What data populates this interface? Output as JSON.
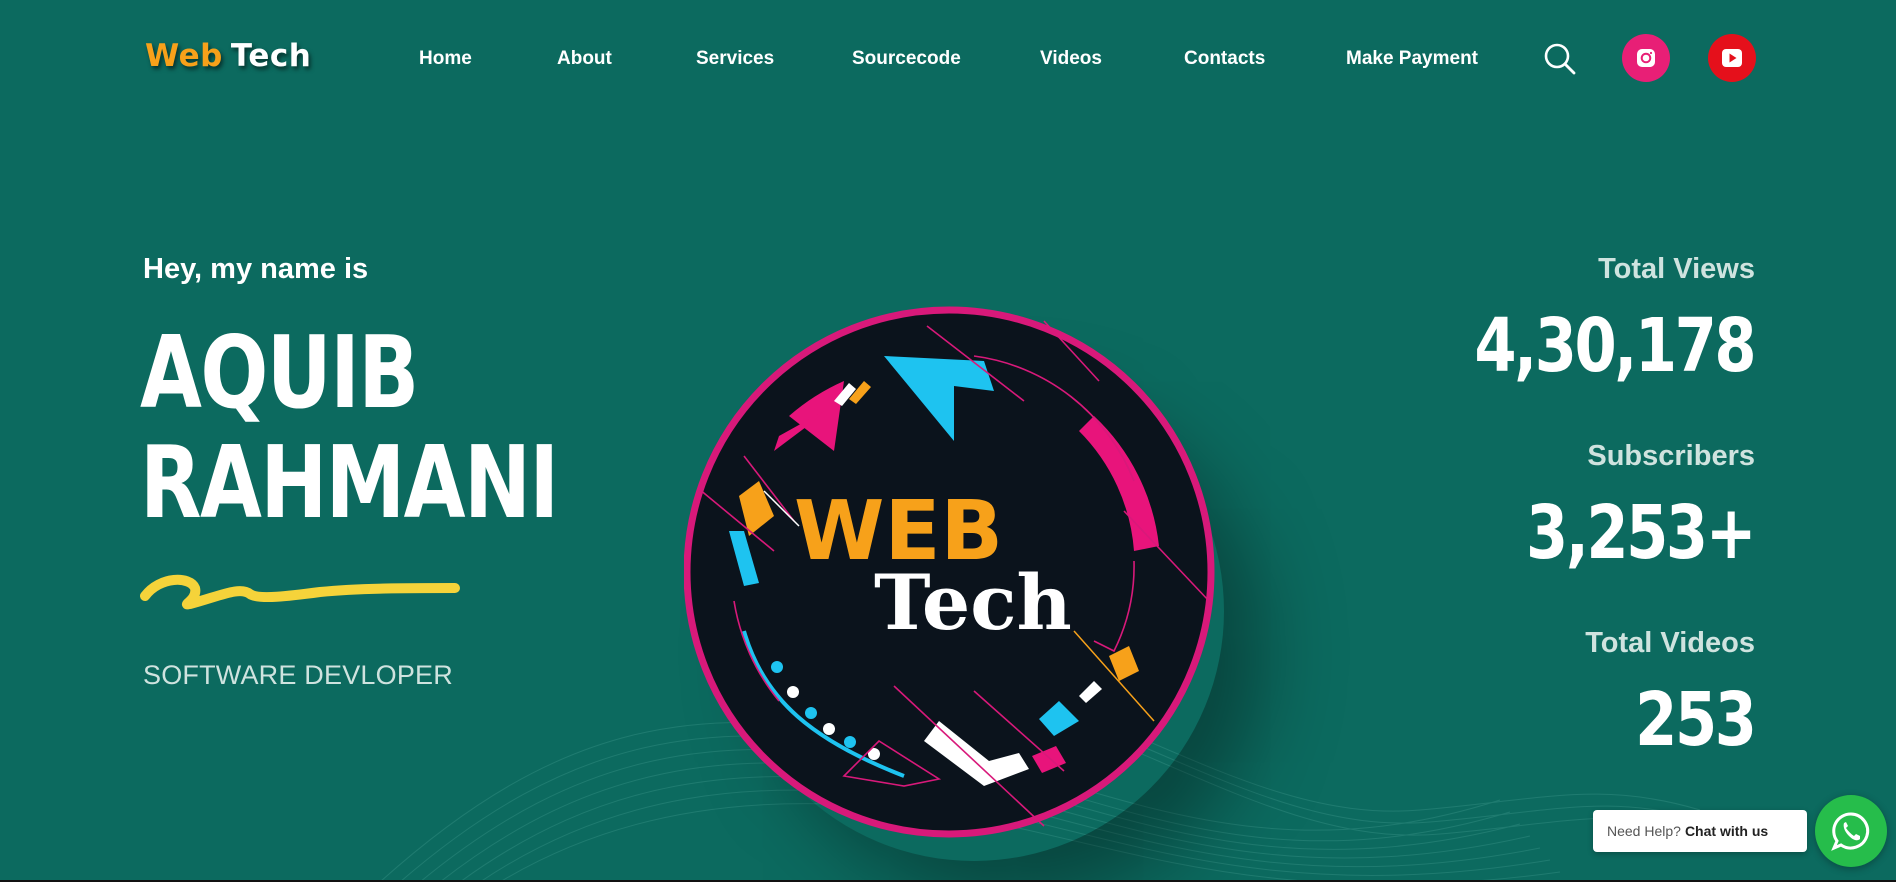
{
  "logo": {
    "part1": "Web",
    "part2": "Tech"
  },
  "nav": {
    "items": [
      {
        "label": "Home"
      },
      {
        "label": "About"
      },
      {
        "label": "Services"
      },
      {
        "label": "Sourcecode"
      },
      {
        "label": "Videos"
      },
      {
        "label": "Contacts"
      },
      {
        "label": "Make Payment"
      }
    ]
  },
  "icons": {
    "search": "search-icon",
    "instagram": "instagram-icon",
    "youtube": "youtube-icon",
    "whatsapp": "whatsapp-icon"
  },
  "hero": {
    "greeting": "Hey, my name is",
    "first_name": "AQUIB",
    "last_name": "RAHMANI",
    "role": "SOFTWARE DEVLOPER"
  },
  "emblem": {
    "line1": "WEB",
    "line2": "Tech"
  },
  "stats": [
    {
      "label": "Total Views",
      "value": "4,30,178"
    },
    {
      "label": "Subscribers",
      "value": "3,253+"
    },
    {
      "label": "Total Videos",
      "value": "253"
    }
  ],
  "chat": {
    "prefix": "Need Help?",
    "cta": "Chat with us"
  },
  "colors": {
    "background": "#0c6a5f",
    "accent_orange": "#f7a11a",
    "instagram": "#e81f76",
    "youtube": "#e5101b",
    "whatsapp": "#26bd4b",
    "emblem_ring": "#d8197a",
    "emblem_cyan": "#1ec3f0",
    "squiggle": "#f5d33a"
  }
}
